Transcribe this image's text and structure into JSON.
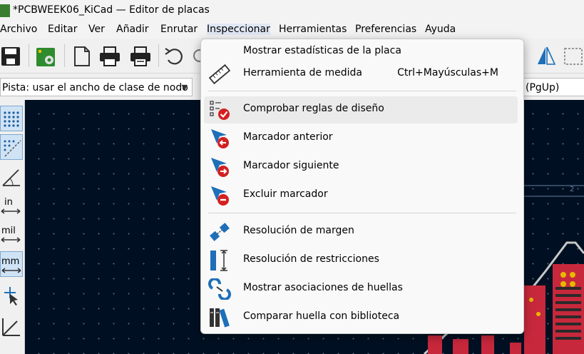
{
  "window": {
    "title": "*PCBWEEK06_KiCad — Editor de placas",
    "app_icon": "kicad-pcb-icon"
  },
  "menubar": {
    "items": [
      "Archivo",
      "Editar",
      "Ver",
      "Añadir",
      "Enrutar",
      "Inspeccionar",
      "Herramientas",
      "Preferencias",
      "Ayuda"
    ],
    "active": "Inspeccionar"
  },
  "toolbar": {
    "icons": [
      "save-icon",
      "board-setup-icon",
      "page-settings-icon",
      "print-icon",
      "plot-icon",
      "undo-icon",
      "redo-icon",
      "flip-icon",
      "zoom-selection-icon"
    ]
  },
  "options_bar": {
    "track_width": "Pista: usar el ancho de clase de nodo",
    "layer_selector": "(PgUp)"
  },
  "left_toolbar": {
    "icons": [
      "grid-dots-icon",
      "grid-overrides-icon",
      "polar-coordinates-icon",
      "inches-icon",
      "mils-icon",
      "millimeters-icon",
      "cursor-crosshair-icon",
      "angle-45-icon"
    ],
    "labels": {
      "inches": "in",
      "mils": "mil",
      "millimeters": "mm"
    }
  },
  "canvas": {
    "background": "#001022",
    "grid_color": "#5a6c80",
    "edge_cut_label": "2"
  },
  "inspect_menu": {
    "items": [
      {
        "icon": "board-statistics-icon",
        "label": "Mostrar estadísticas de la placa",
        "shortcut": ""
      },
      {
        "icon": "measure-tool-icon",
        "label": "Herramienta de medida",
        "shortcut": "Ctrl+Mayúsculas+M"
      },
      {
        "icon": "drc-check-icon",
        "label": "Comprobar reglas de diseño",
        "shortcut": "",
        "highlighted": true
      },
      {
        "icon": "previous-marker-icon",
        "label": "Marcador anterior",
        "shortcut": ""
      },
      {
        "icon": "next-marker-icon",
        "label": "Marcador siguiente",
        "shortcut": ""
      },
      {
        "icon": "exclude-marker-icon",
        "label": "Excluir marcador",
        "shortcut": ""
      },
      {
        "icon": "clearance-resolution-icon",
        "label": "Resolución de margen",
        "shortcut": ""
      },
      {
        "icon": "constraints-resolution-icon",
        "label": "Resolución de restricciones",
        "shortcut": ""
      },
      {
        "icon": "footprint-associations-icon",
        "label": "Mostrar asociaciones de huellas",
        "shortcut": ""
      },
      {
        "icon": "compare-footprint-library-icon",
        "label": "Comparar huella con biblioteca",
        "shortcut": ""
      }
    ]
  },
  "colors": {
    "accent_blue": "#1e6fb8",
    "marker_red": "#d42020",
    "highlight": "#ebebeb",
    "pcb_pad": "#c8283c"
  }
}
